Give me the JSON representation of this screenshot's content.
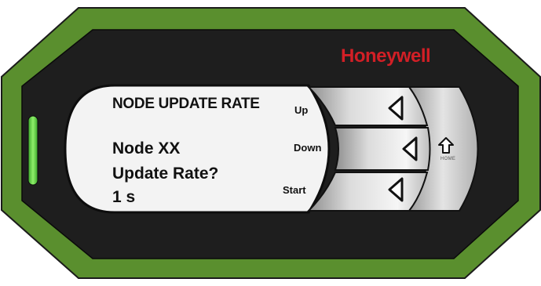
{
  "brand": {
    "name": "Honeywell",
    "color": "#d21f26"
  },
  "display": {
    "title": "NODE UPDATE RATE",
    "line1": "Node XX",
    "line2": "Update Rate?",
    "line3": "1 s"
  },
  "keys": {
    "up": {
      "label": "Up",
      "icon": "left-arrow-icon"
    },
    "down": {
      "label": "Down",
      "icon": "left-arrow-icon"
    },
    "start": {
      "label": "Start",
      "icon": "left-arrow-icon"
    },
    "home": {
      "label": "HOME",
      "icon": "up-arrow-icon"
    }
  },
  "status_led": {
    "color": "#5bd143",
    "state": "on"
  },
  "colors": {
    "bezel_outer": "#5a8f2e",
    "bezel_inner": "#1e1e1e",
    "lcd": "#f3f3f3"
  }
}
